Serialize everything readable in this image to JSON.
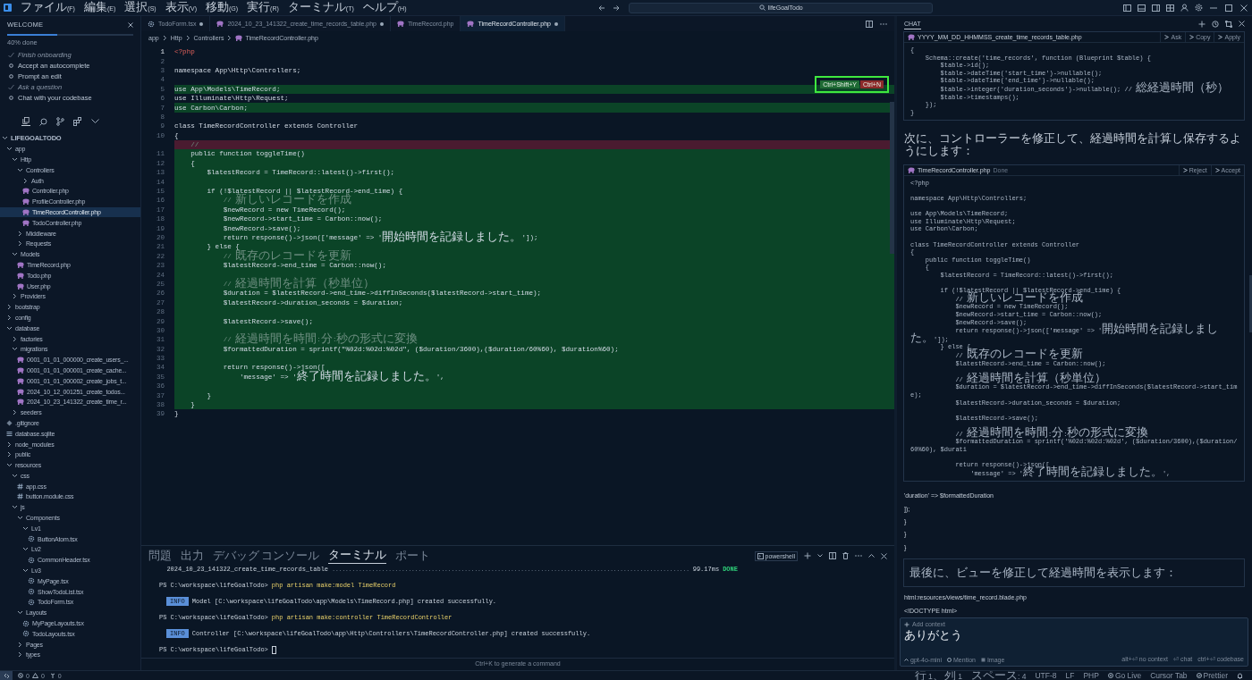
{
  "title_bar": {
    "menus": [
      "ファイル(F)",
      "編集(E)",
      "選択(S)",
      "表示(V)",
      "移動(G)",
      "実行(R)",
      "ターミナル(T)",
      "ヘルプ(H)"
    ],
    "search": "lifeGoalTodo"
  },
  "welcome": {
    "title": "WELCOME",
    "level": 0.4,
    "progress_text": "40% done",
    "steps": [
      {
        "label": "Finish onboarding",
        "checked": true
      },
      {
        "label": "Accept an autocomplete",
        "checked": false
      },
      {
        "label": "Prompt an edit",
        "checked": false
      },
      {
        "label": "Ask a question",
        "checked": true
      },
      {
        "label": "Chat with your codebase",
        "checked": false
      }
    ]
  },
  "explorer": {
    "title": "LIFEGOALTODO",
    "expanded": true,
    "tree": [
      {
        "label": "app",
        "kind": "folder",
        "expanded": true,
        "selected": false,
        "children": [
          {
            "label": "Http",
            "kind": "folder",
            "expanded": true,
            "selected": false,
            "children": [
              {
                "label": "Controllers",
                "kind": "folder",
                "expanded": true,
                "selected": false,
                "children": [
                  {
                    "label": "Auth",
                    "kind": "folder",
                    "expanded": false,
                    "selected": false
                  },
                  {
                    "label": "Controller.php",
                    "kind": "php",
                    "selected": false
                  },
                  {
                    "label": "ProfileController.php",
                    "kind": "php",
                    "selected": false
                  },
                  {
                    "label": "TimeRecordController.php",
                    "kind": "php",
                    "selected": true
                  },
                  {
                    "label": "TodoController.php",
                    "kind": "php",
                    "selected": false
                  }
                ]
              },
              {
                "label": "Middleware",
                "kind": "folder",
                "expanded": false,
                "selected": false
              },
              {
                "label": "Requests",
                "kind": "folder",
                "expanded": false,
                "selected": false
              }
            ]
          },
          {
            "label": "Models",
            "kind": "folder",
            "expanded": true,
            "selected": false,
            "children": [
              {
                "label": "TimeRecord.php",
                "kind": "php",
                "selected": false
              },
              {
                "label": "Todo.php",
                "kind": "php",
                "selected": false
              },
              {
                "label": "User.php",
                "kind": "php",
                "selected": false
              }
            ]
          },
          {
            "label": "Providers",
            "kind": "folder",
            "expanded": false,
            "selected": false
          }
        ]
      },
      {
        "label": "bootstrap",
        "kind": "folder",
        "expanded": false,
        "selected": false
      },
      {
        "label": "config",
        "kind": "folder",
        "expanded": false,
        "selected": false
      },
      {
        "label": "database",
        "kind": "folder",
        "expanded": true,
        "selected": false,
        "children": [
          {
            "label": "factories",
            "kind": "folder",
            "expanded": false,
            "selected": false
          },
          {
            "label": "migrations",
            "kind": "folder",
            "expanded": true,
            "selected": false,
            "children": [
              {
                "label": "0001_01_01_000000_create_users_...",
                "kind": "php",
                "selected": false
              },
              {
                "label": "0001_01_01_000001_create_cache...",
                "kind": "php",
                "selected": false
              },
              {
                "label": "0001_01_01_000002_create_jobs_t...",
                "kind": "php",
                "selected": false
              },
              {
                "label": "2024_10_12_001251_create_todos...",
                "kind": "php",
                "selected": false
              },
              {
                "label": "2024_10_23_141322_create_time_r...",
                "kind": "php",
                "selected": false
              }
            ]
          },
          {
            "label": "seeders",
            "kind": "folder",
            "expanded": false,
            "selected": false
          }
        ]
      },
      {
        "label": ".gitignore",
        "kind": "git",
        "selected": false
      },
      {
        "label": "database.sqlite",
        "kind": "db",
        "selected": false
      },
      {
        "label": "node_modules",
        "kind": "folder",
        "expanded": false,
        "selected": false
      },
      {
        "label": "public",
        "kind": "folder",
        "expanded": false,
        "selected": false
      },
      {
        "label": "resources",
        "kind": "folder",
        "expanded": true,
        "selected": false,
        "children": [
          {
            "label": "css",
            "kind": "folder",
            "expanded": true,
            "selected": false,
            "children": [
              {
                "label": "app.css",
                "kind": "css",
                "selected": false
              },
              {
                "label": "button.module.css",
                "kind": "css",
                "selected": false
              }
            ]
          },
          {
            "label": "js",
            "kind": "folder",
            "expanded": true,
            "selected": false,
            "children": [
              {
                "label": "Components",
                "kind": "folder",
                "expanded": true,
                "selected": false,
                "children": [
                  {
                    "label": "Lv1",
                    "kind": "folder",
                    "expanded": true,
                    "selected": false,
                    "children": [
                      {
                        "label": "ButtonAtom.tsx",
                        "kind": "tsx",
                        "selected": false
                      }
                    ]
                  },
                  {
                    "label": "Lv2",
                    "kind": "folder",
                    "expanded": true,
                    "selected": false,
                    "children": [
                      {
                        "label": "CommonHeader.tsx",
                        "kind": "tsx",
                        "selected": false
                      }
                    ]
                  },
                  {
                    "label": "Lv3",
                    "kind": "folder",
                    "expanded": true,
                    "selected": false,
                    "children": [
                      {
                        "label": "MyPage.tsx",
                        "kind": "tsx",
                        "selected": false
                      },
                      {
                        "label": "ShowTodoList.tsx",
                        "kind": "tsx",
                        "selected": false
                      },
                      {
                        "label": "TodoForm.tsx",
                        "kind": "tsx",
                        "selected": false
                      }
                    ]
                  }
                ]
              },
              {
                "label": "Layouts",
                "kind": "folder",
                "expanded": true,
                "selected": false,
                "children": [
                  {
                    "label": "MyPageLayouts.tsx",
                    "kind": "tsx",
                    "selected": false
                  },
                  {
                    "label": "TodoLayouts.tsx",
                    "kind": "tsx",
                    "selected": false
                  }
                ]
              },
              {
                "label": "Pages",
                "kind": "folder",
                "expanded": false,
                "selected": false
              },
              {
                "label": "types",
                "kind": "folder",
                "expanded": false,
                "selected": false
              }
            ]
          }
        ]
      }
    ]
  },
  "editor": {
    "tabs": [
      {
        "label": "TodoForm.tsx",
        "kind": "tsx",
        "modified": true,
        "selected": false
      },
      {
        "label": "2024_10_23_141322_create_time_records_table.php",
        "kind": "php",
        "modified": true,
        "selected": false
      },
      {
        "label": "TimeRecord.php",
        "kind": "php",
        "modified": false,
        "selected": false
      },
      {
        "label": "TimeRecordController.php",
        "kind": "php",
        "modified": true,
        "selected": true
      }
    ],
    "breadcrumb": [
      "app",
      "Http",
      "Controllers",
      "TimeRecordController.php"
    ],
    "lines": [
      {
        "number": "1",
        "text": "<?php",
        "kind": "tag",
        "added": false
      },
      {
        "number": "2",
        "added": false
      },
      {
        "number": "3",
        "text": "namespace App\\Http\\Controllers;",
        "kind": "code",
        "added": false
      },
      {
        "number": "4",
        "added": false
      },
      {
        "number": "5",
        "text": "use App\\Models\\TimeRecord;",
        "kind": "code",
        "added": true
      },
      {
        "number": "6",
        "text": "use Illuminate\\Http\\Request;",
        "kind": "code",
        "added": false
      },
      {
        "number": "7",
        "text": "use Carbon\\Carbon;",
        "kind": "code",
        "added": true
      },
      {
        "number": "8",
        "added": false
      },
      {
        "number": "9",
        "text": "class TimeRecordController extends Controller",
        "kind": "code",
        "added": false
      },
      {
        "number": "10",
        "text": "{",
        "kind": "code",
        "added": false
      },
      {
        "text": "    //",
        "kind": "comment",
        "added": false,
        "removed": true
      },
      {
        "number": "11",
        "text": "    public function toggleTime()",
        "kind": "code",
        "added": true
      },
      {
        "number": "12",
        "text": "    {",
        "kind": "code",
        "added": true
      },
      {
        "number": "13",
        "text": "        $latestRecord = TimeRecord::latest()->first();",
        "kind": "code",
        "added": true
      },
      {
        "number": "14",
        "added": true
      },
      {
        "number": "15",
        "text": "        if (!$latestRecord || $latestRecord->end_time) {",
        "kind": "code",
        "added": true
      },
      {
        "number": "16",
        "text": "            // 新しいレコードを作成",
        "kind": "comment",
        "added": true
      },
      {
        "number": "17",
        "text": "            $newRecord = new TimeRecord();",
        "kind": "code",
        "added": true
      },
      {
        "number": "18",
        "text": "            $newRecord->start_time = Carbon::now();",
        "kind": "code",
        "added": true
      },
      {
        "number": "19",
        "text": "            $newRecord->save();",
        "kind": "code",
        "added": true
      },
      {
        "number": "20",
        "text": "            return response()->json(['message' => '開始時間を記録しました。']);",
        "kind": "code",
        "added": true
      },
      {
        "number": "21",
        "text": "        } else {",
        "kind": "code",
        "added": true
      },
      {
        "number": "22",
        "text": "            // 既存のレコードを更新",
        "kind": "comment",
        "added": true
      },
      {
        "number": "23",
        "text": "            $latestRecord->end_time = Carbon::now();",
        "kind": "code",
        "added": true
      },
      {
        "number": "24",
        "added": true
      },
      {
        "number": "25",
        "text": "            // 経過時間を計算（秒単位）",
        "kind": "comment",
        "added": true
      },
      {
        "number": "26",
        "text": "            $duration = $latestRecord->end_time->diffInSeconds($latestRecord->start_time);",
        "kind": "code",
        "added": true
      },
      {
        "number": "27",
        "text": "            $latestRecord->duration_seconds = $duration;",
        "kind": "code",
        "added": true
      },
      {
        "number": "28",
        "added": true
      },
      {
        "number": "29",
        "text": "            $latestRecord->save();",
        "kind": "code",
        "added": true
      },
      {
        "number": "30",
        "added": true
      },
      {
        "number": "31",
        "text": "            // 経過時間を時間:分:秒の形式に変換",
        "kind": "comment",
        "added": true
      },
      {
        "number": "32",
        "text": "            $formattedDuration = sprintf(\"%02d:%02d:%02d\", ($duration/3600),($duration/60%60), $duration%60);",
        "kind": "code",
        "added": true
      },
      {
        "number": "33",
        "added": true
      },
      {
        "number": "34",
        "text": "            return response()->json([",
        "kind": "code",
        "added": true
      },
      {
        "number": "35",
        "text": "                'message' => '終了時間を記録しました。',",
        "kind": "code",
        "added": true
      },
      {
        "number": "36",
        "added": true
      },
      {
        "number": "37",
        "text": "        }",
        "kind": "code",
        "added": true
      },
      {
        "number": "38",
        "text": "    }",
        "kind": "code",
        "added": true
      },
      {
        "number": "39",
        "text": "}",
        "kind": "code",
        "added": false
      }
    ],
    "diff_actions": [
      {
        "label": "Ctrl+Shift+Y",
        "kind": "accept"
      },
      {
        "label": "Ctrl+N",
        "kind": "reject"
      }
    ]
  },
  "terminal": {
    "tabs": [
      {
        "label": "問題",
        "selected": false
      },
      {
        "label": "出力",
        "selected": false
      },
      {
        "label": "デバッグ コンソール",
        "selected": false
      },
      {
        "label": "ターミナル",
        "selected": true
      },
      {
        "label": "ポート",
        "selected": false
      }
    ],
    "shell": "powershell",
    "lines": [
      {
        "kind": "migration",
        "text": "2024_10_23_141322_create_time_records_table",
        "dots": "............................................................................................................",
        "time": "99.17ms",
        "status": "DONE"
      },
      {
        "kind": "prompt",
        "prompt": "PS C:\\workspace\\lifeGoalTodo>",
        "command": "php artisan make:model TimeRecord"
      },
      {
        "kind": "info",
        "badge": "INFO",
        "text": "Model [C:\\workspace\\lifeGoalTodo\\app\\Models\\TimeRecord.php] created successfully."
      },
      {
        "kind": "prompt",
        "prompt": "PS C:\\workspace\\lifeGoalTodo>",
        "command": "php artisan make:controller TimeRecordController"
      },
      {
        "kind": "info",
        "badge": "INFO",
        "text": "Controller [C:\\workspace\\lifeGoalTodo\\app\\Http\\Controllers\\TimeRecordController.php] created successfully."
      },
      {
        "kind": "prompt",
        "prompt": "PS C:\\workspace\\lifeGoalTodo>",
        "cursor": true
      }
    ],
    "hint": "Ctrl+K to generate a command"
  },
  "chat": {
    "title": "CHAT",
    "items": [
      {
        "kind": "code",
        "file": "YYYY_MM_DD_HHMMSS_create_time_records_table.php",
        "actions": [
          "Ask",
          "Copy",
          "Apply"
        ],
        "code": "{\n    Schema::create('time_records', function (Blueprint $table) {\n        $table->id();\n        $table->dateTime('start_time')->nullable();\n        $table->dateTime('end_time')->nullable();\n        $table->integer('duration_seconds')->nullable(); // 総経過時間（秒）\n        $table->timestamps();\n    });\n}"
      },
      {
        "kind": "text",
        "text": "次に、コントローラーを修正して、経過時間を計算し保存するようにします："
      },
      {
        "kind": "code",
        "file": "TimeRecordController.php",
        "status": "Done",
        "actions": [
          "Reject",
          "Accept"
        ],
        "code": "<?php\n\nnamespace App\\Http\\Controllers;\n\nuse App\\Models\\TimeRecord;\nuse Illuminate\\Http\\Request;\nuse Carbon\\Carbon;\n\nclass TimeRecordController extends Controller\n{\n    public function toggleTime()\n    {\n        $latestRecord = TimeRecord::latest()->first();\n\n        if (!$latestRecord || $latestRecord->end_time) {\n            // 新しいレコードを作成\n            $newRecord = new TimeRecord();\n            $newRecord->start_time = Carbon::now();\n            $newRecord->save();\n            return response()->json(['message' => '開始時間を記録しました。']);\n        } else {\n            // 既存のレコードを更新\n            $latestRecord->end_time = Carbon::now();\n\n            // 経過時間を計算（秒単位）\n            $duration = $latestRecord->end_time->diffInSeconds($latestRecord->start_time);\n            $latestRecord->duration_seconds = $duration;\n\n            $latestRecord->save();\n\n            // 経過時間を時間:分:秒の形式に変換\n            $formattedDuration = sprintf('%02d:%02d:%02d', ($duration/3600),($duration/60%60), $durati\n\n            return response()->json([\n                'message' => '終了時間を記録しました。',"
      },
      {
        "kind": "text",
        "text": "'duration' => $formattedDuration"
      },
      {
        "kind": "text",
        "text": "]);"
      },
      {
        "kind": "text",
        "text": "}"
      },
      {
        "kind": "text",
        "text": "}"
      },
      {
        "kind": "text",
        "text": "}"
      },
      {
        "kind": "note",
        "text": "最後に、ビューを修正して経過時間を表示します："
      },
      {
        "kind": "text",
        "text": "html:resources/views/time_record.blade.php"
      },
      {
        "kind": "text",
        "text": "<!DOCTYPE html>"
      }
    ],
    "input": {
      "context": "Add context",
      "value": "ありがとう",
      "model": "gpt-4o-mini",
      "tools": [
        "Mention",
        "Image"
      ],
      "shortcuts": [
        "alt+⏎ no context",
        "⏎ chat",
        "ctrl+⏎ codebase"
      ]
    }
  },
  "status_bar": {
    "errors": "0",
    "warnings": "0",
    "ports": "0",
    "items": [
      {
        "text": "行 1、列 1",
        "kind": "plain"
      },
      {
        "text": "スペース: 4",
        "kind": "plain"
      },
      {
        "text": "UTF-8",
        "kind": "plain"
      },
      {
        "text": "LF",
        "kind": "plain"
      },
      {
        "text": "PHP",
        "kind": "plain"
      },
      {
        "text": "Go Live",
        "kind": "live"
      },
      {
        "text": "Cursor Tab",
        "kind": "plain"
      },
      {
        "text": "Prettier",
        "kind": "check"
      }
    ]
  }
}
